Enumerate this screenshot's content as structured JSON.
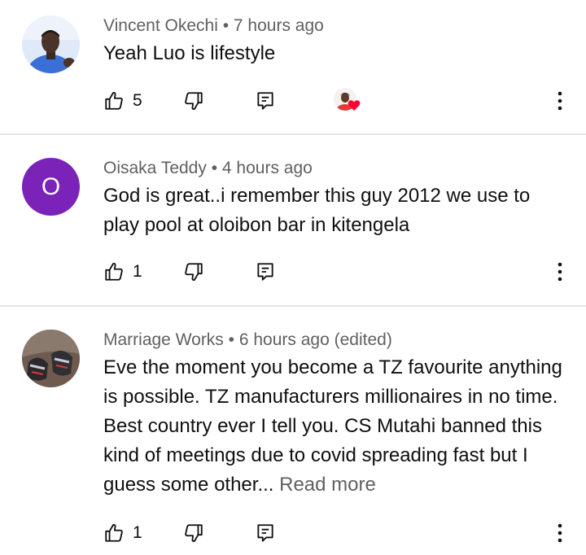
{
  "comments": [
    {
      "author": "Vincent Okechi",
      "separator": "•",
      "time": "7 hours ago",
      "text": "Yeah Luo is lifestyle",
      "likes": "5",
      "avatar_type": "photo",
      "creator_heart": true
    },
    {
      "author": "Oisaka Teddy",
      "separator": "•",
      "time": "4 hours ago",
      "text": "God is great..i remember this guy 2012 we use to play pool at oloibon bar in kitengela",
      "likes": "1",
      "avatar_type": "letter",
      "avatar_letter": "O",
      "avatar_color": "#7b22b8"
    },
    {
      "author": "Marriage Works",
      "separator": "•",
      "time": "6 hours ago (edited)",
      "text": "Eve the moment you become a TZ favourite anything is possible. TZ manufacturers millionaires in no time. Best country ever I tell you. CS Mutahi banned this kind of meetings due to covid spreading fast but I guess some other...",
      "read_more": "Read more",
      "likes": "1",
      "avatar_type": "photo"
    }
  ],
  "icons": {
    "like": "thumbs-up-icon",
    "dislike": "thumbs-down-icon",
    "reply": "reply-icon",
    "more": "more-vertical-icon",
    "heart": "heart-icon"
  },
  "colors": {
    "text": "#0f0f0f",
    "meta": "#606060",
    "divider": "#e5e5e5",
    "heart": "#ff0033"
  }
}
